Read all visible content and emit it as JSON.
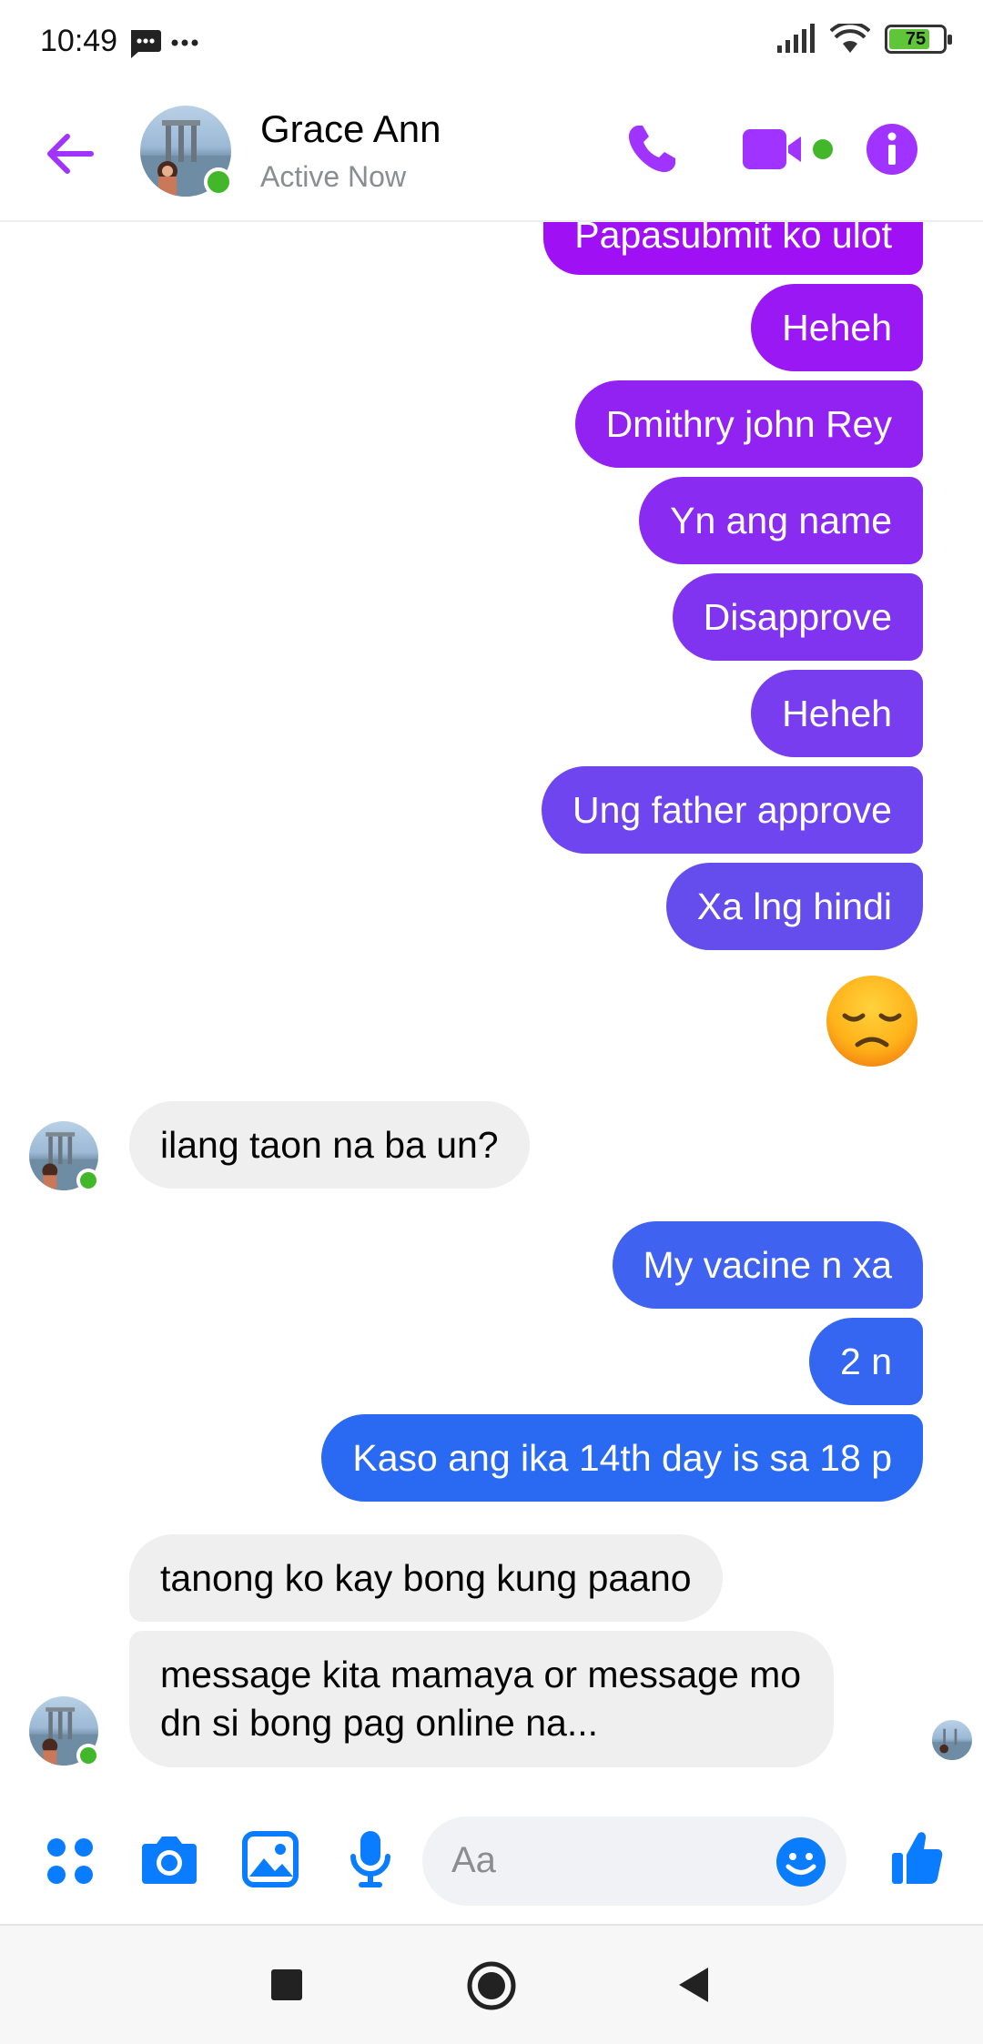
{
  "status_bar": {
    "time": "10:49",
    "battery": "75",
    "icons": [
      "message-notification-icon",
      "more-dots-icon",
      "signal-icon",
      "wifi-icon",
      "battery-icon"
    ]
  },
  "header": {
    "contact_name": "Grace Ann",
    "contact_status": "Active Now",
    "accent_color": "#a033ff",
    "icons": [
      "back-arrow-icon",
      "phone-icon",
      "video-camera-icon",
      "info-icon"
    ]
  },
  "messages": [
    {
      "direction": "out",
      "text": "Papasubmit ko ulot",
      "color": "#a010f4"
    },
    {
      "direction": "out",
      "text": "Heheh",
      "color": "#9a18f3"
    },
    {
      "direction": "out",
      "text": "Dmithry john Rey",
      "color": "#9222f2"
    },
    {
      "direction": "out",
      "text": "Yn ang name",
      "color": "#8a2bf1"
    },
    {
      "direction": "out",
      "text": "Disapprove",
      "color": "#8134f0"
    },
    {
      "direction": "out",
      "text": "Heheh",
      "color": "#773def"
    },
    {
      "direction": "out",
      "text": "Ung father approve",
      "color": "#6e45ee"
    },
    {
      "direction": "out",
      "text": "Xa lng hindi",
      "color": "#654ded"
    },
    {
      "direction": "out",
      "type": "emoji",
      "text": "😞"
    },
    {
      "direction": "in",
      "text": "ilang taon na ba un?"
    },
    {
      "direction": "out",
      "text": "My vacine n xa",
      "color": "#3f62f0"
    },
    {
      "direction": "out",
      "text": "2 n",
      "color": "#3566f1"
    },
    {
      "direction": "out",
      "text": "Kaso ang ika 14th day is sa 18 p",
      "color": "#2a6af2"
    },
    {
      "direction": "in",
      "text": "tanong ko kay bong kung paano"
    },
    {
      "direction": "in",
      "text": "message kita mamaya or message mo dn si bong pag online na..."
    }
  ],
  "composer": {
    "placeholder": "Aa",
    "icon_color": "#0a7cff",
    "icons": [
      "more-actions-icon",
      "camera-icon",
      "gallery-icon",
      "microphone-icon",
      "emoji-icon",
      "thumbs-up-icon"
    ]
  },
  "navbar": {
    "icons": [
      "recents-square-icon",
      "home-circle-icon",
      "back-triangle-icon"
    ]
  }
}
